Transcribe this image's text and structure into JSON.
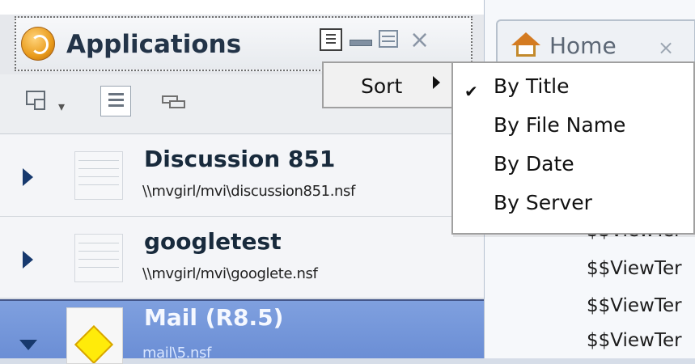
{
  "left_panel": {
    "header": {
      "title": "Applications",
      "icons": [
        "applications-icon",
        "sort-icon",
        "minimize-icon",
        "maximize-icon",
        "close-icon"
      ]
    },
    "toolbar": {
      "icons": [
        "copy-icon",
        "dropdown-arrow-icon",
        "list-icon",
        "stack-icon"
      ]
    },
    "items": [
      {
        "title": "Discussion 851",
        "path": "\\\\mvgirl/mvi\\discussion851.nsf",
        "expand_icon": "expand-right-icon",
        "db_icon": "database-icon"
      },
      {
        "title": "googletest",
        "path": "\\\\mvgirl/mvi\\googlete.nsf",
        "expand_icon": "expand-right-icon",
        "db_icon": "database-icon"
      },
      {
        "title": "Mail (R8.5)",
        "path": "mail\\5.nsf",
        "expand_icon": "expand-down-icon",
        "db_icon": "mail-icon"
      }
    ]
  },
  "right_panel": {
    "tab": {
      "label": "Home",
      "icon": "home-icon",
      "close": "×"
    },
    "view_rows": [
      "$$ViewTer",
      "$$ViewTer",
      "$$ViewTer",
      "$$ViewTer"
    ]
  },
  "context_menu": {
    "sort_label": "Sort",
    "submenu": [
      {
        "label": "By Title",
        "checked": true
      },
      {
        "label": "By File Name",
        "checked": false
      },
      {
        "label": "By Date",
        "checked": false
      },
      {
        "label": "By Server",
        "checked": false
      }
    ],
    "check_mark": "✔"
  },
  "colors": {
    "selected_row": "#6b8ed5",
    "accent": "#17396e"
  }
}
